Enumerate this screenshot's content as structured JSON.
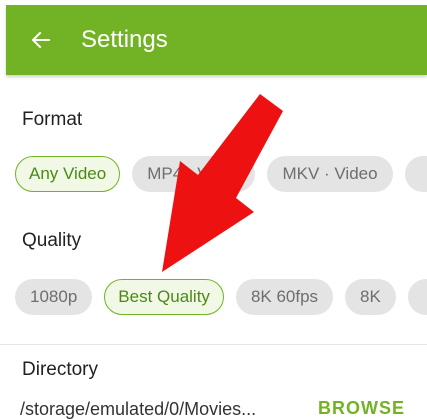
{
  "appbar": {
    "title": "Settings",
    "back_icon": "arrow-left-icon",
    "color": "#72b325"
  },
  "format": {
    "label": "Format",
    "chips": [
      {
        "label": "Any Video",
        "selected": true
      },
      {
        "label": "MP4 · Video",
        "selected": false
      },
      {
        "label": "MKV · Video",
        "selected": false
      },
      {
        "label": "",
        "selected": false
      }
    ]
  },
  "quality": {
    "label": "Quality",
    "chips": [
      {
        "label": "1080p",
        "selected": false
      },
      {
        "label": "Best Quality",
        "selected": true
      },
      {
        "label": "8K 60fps",
        "selected": false
      },
      {
        "label": "8K",
        "selected": false
      },
      {
        "label": "",
        "selected": false
      }
    ]
  },
  "directory": {
    "label": "Directory",
    "path": "/storage/emulated/0/Movies...",
    "browse_label": "BROWSE"
  },
  "annotation": {
    "arrow_color": "#ee1111",
    "arrow_icon": "red-arrow-icon"
  }
}
